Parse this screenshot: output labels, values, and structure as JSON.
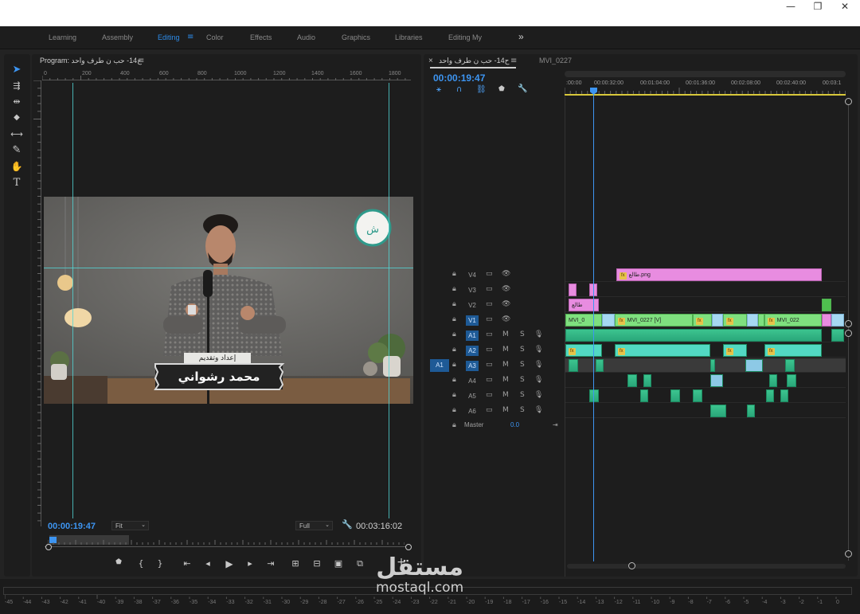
{
  "window": {
    "controls": [
      "—",
      "❐",
      "✕"
    ]
  },
  "workspaces": {
    "tabs": [
      {
        "label": "Learning"
      },
      {
        "label": "Assembly"
      },
      {
        "label": "Editing",
        "active": true
      },
      {
        "label": "Color"
      },
      {
        "label": "Effects"
      },
      {
        "label": "Audio"
      },
      {
        "label": "Graphics"
      },
      {
        "label": "Libraries"
      },
      {
        "label": "Editing My"
      }
    ],
    "more_icon": "»",
    "menu_icon": "≡"
  },
  "tools": [
    {
      "name": "selection-tool-icon",
      "glyph": "➤",
      "active": true
    },
    {
      "name": "track-select-tool-icon",
      "glyph": "⇶"
    },
    {
      "name": "ripple-edit-tool-icon",
      "glyph": "⇹"
    },
    {
      "name": "razor-tool-icon",
      "glyph": "◆"
    },
    {
      "name": "slip-tool-icon",
      "glyph": "⟷"
    },
    {
      "name": "pen-tool-icon",
      "glyph": "✎"
    },
    {
      "name": "hand-tool-icon",
      "glyph": "✋"
    },
    {
      "name": "type-tool-icon",
      "glyph": "T"
    }
  ],
  "program": {
    "title": "Program: ح14- حب ن طرف واحد",
    "menu_icon": "≡",
    "ruler_ticks": [
      "0",
      "200",
      "400",
      "600",
      "800",
      "1000",
      "1200",
      "1400",
      "1600",
      "1800"
    ],
    "timecode_current": "00:00:19:47",
    "fit_label": "Fit",
    "quality_label": "Full",
    "timecode_duration": "00:03:16:02",
    "overlay": {
      "caption_small": "إعداد وتقديم",
      "caption_name": "محمد رشواني"
    },
    "controls": [
      {
        "name": "add-marker-icon",
        "glyph": "⬟"
      },
      {
        "name": "mark-in-icon",
        "glyph": "{"
      },
      {
        "name": "mark-out-icon",
        "glyph": "}"
      },
      {
        "name": "go-to-in-icon",
        "glyph": "⇤"
      },
      {
        "name": "step-back-icon",
        "glyph": "◂"
      },
      {
        "name": "play-icon",
        "glyph": "▶"
      },
      {
        "name": "step-forward-icon",
        "glyph": "▸"
      },
      {
        "name": "go-to-out-icon",
        "glyph": "⇥"
      },
      {
        "name": "lift-icon",
        "glyph": "⊞"
      },
      {
        "name": "extract-icon",
        "glyph": "⊟"
      },
      {
        "name": "export-frame-icon",
        "glyph": "▣"
      },
      {
        "name": "comparison-view-icon",
        "glyph": "⧉"
      }
    ],
    "add_button_glyph": "+"
  },
  "timeline": {
    "close_glyph": "×",
    "active_tab": "ح14- حب ن طرف واحد",
    "menu_icon": "≡",
    "other_tab": "MVI_0227",
    "timecode": "00:00:19:47",
    "ruler_labels": [
      ":00:00",
      "00:00:32:00",
      "00:01:04:00",
      "00:01:36:00",
      "00:02:08:00",
      "00:02:40:00",
      "00:03:1"
    ],
    "tracks": [
      {
        "id": "V4",
        "type": "video"
      },
      {
        "id": "V3",
        "type": "video"
      },
      {
        "id": "V2",
        "type": "video"
      },
      {
        "id": "V1",
        "type": "video",
        "selected": true
      },
      {
        "id": "A1",
        "type": "audio",
        "selected": true
      },
      {
        "id": "A2",
        "type": "audio",
        "selected": true
      },
      {
        "id": "A3",
        "type": "audio",
        "selected": true,
        "source": "A1"
      },
      {
        "id": "A4",
        "type": "audio"
      },
      {
        "id": "A5",
        "type": "audio"
      },
      {
        "id": "A6",
        "type": "audio"
      }
    ],
    "mute_label": "M",
    "solo_label": "S",
    "master_label": "Master",
    "master_value": "0.0",
    "clip_labels": {
      "v4_png": "طالع.png",
      "v2_title": "طالع",
      "v1_a": "MVI_0",
      "v1_b": "MVI_0227 [V]",
      "v1_c": "MVI_022"
    }
  },
  "meter": {
    "scale": [
      "-45",
      "-44",
      "-43",
      "-42",
      "-41",
      "-40",
      "-39",
      "-38",
      "-37",
      "-36",
      "-35",
      "-34",
      "-33",
      "-32",
      "-31",
      "-30",
      "-29",
      "-28",
      "-27",
      "-26",
      "-25",
      "-24",
      "-23",
      "-22",
      "-21",
      "-20",
      "-19",
      "-18",
      "-17",
      "-16",
      "-15",
      "-14",
      "-13",
      "-12",
      "-11",
      "-10",
      "-9",
      "-8",
      "-7",
      "-6",
      "-5",
      "-4",
      "-3",
      "-2",
      "-1",
      "0"
    ]
  },
  "watermark": {
    "arabic": "مستقل",
    "latin": "mostaql.com"
  }
}
